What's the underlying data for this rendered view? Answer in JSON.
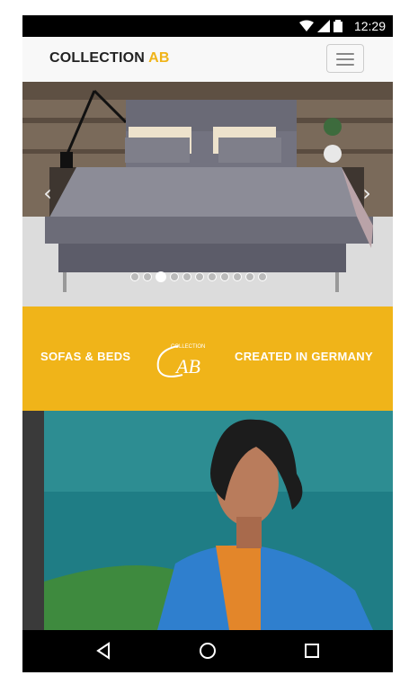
{
  "status_bar": {
    "time": "12:29",
    "icons": [
      "wifi-icon",
      "signal-icon",
      "battery-icon"
    ]
  },
  "header": {
    "brand_main": "COLLECTION",
    "brand_accent": "AB",
    "menu_icon": "hamburger-menu-icon"
  },
  "carousel": {
    "prev_icon": "chevron-left-icon",
    "next_icon": "chevron-right-icon",
    "slide_count": 11,
    "active_index": 2
  },
  "banner": {
    "left_text": "SOFAS & BEDS",
    "right_text": "CREATED IN GERMANY",
    "logo_small": "COLLECTION",
    "logo_large": "AB"
  },
  "colors": {
    "accent": "#f0b419",
    "navbar_bg": "#f8f8f8"
  },
  "system_nav": {
    "back": "back-icon",
    "home": "home-icon",
    "recents": "recents-icon"
  }
}
